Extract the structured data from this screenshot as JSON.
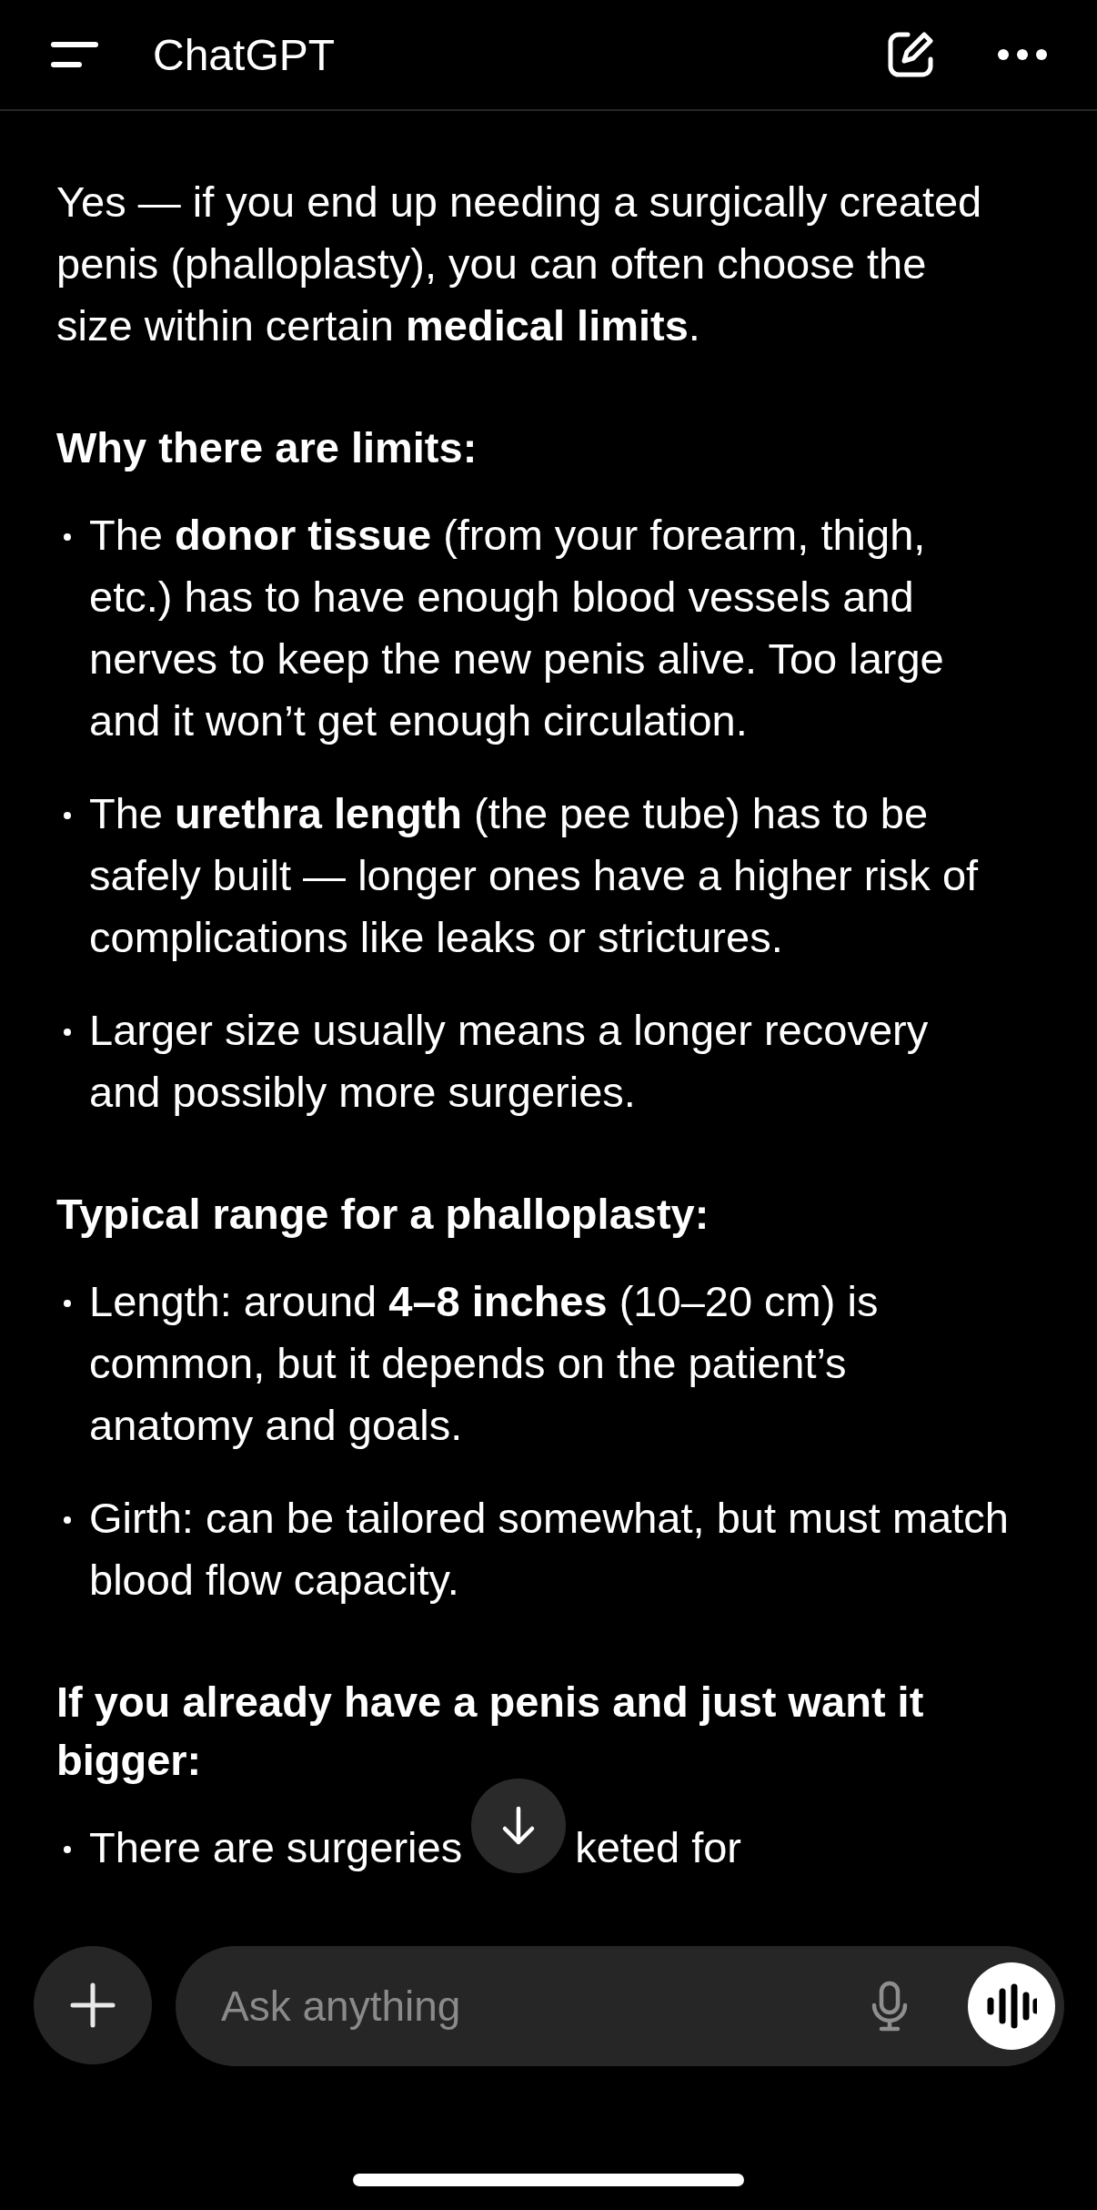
{
  "header": {
    "title": "ChatGPT"
  },
  "message": [
    {
      "kind": "paragraph",
      "text": "Yes — if you end up needing a surgically created penis (phalloplasty), you can often choose the size within certain **medical limits**."
    },
    {
      "kind": "heading",
      "text": "Why there are limits:"
    },
    {
      "kind": "bullets",
      "items": [
        "The **donor tissue** (from your forearm, thigh, etc.) has to have enough blood vessels and nerves to keep the new penis alive. Too large and it won’t get enough circulation.",
        "The **urethra length** (the pee tube) has to be safely built — longer ones have a higher risk of complications like leaks or strictures.",
        "Larger size usually means a longer recovery and possibly more surgeries."
      ]
    },
    {
      "kind": "heading",
      "text": "Typical range for a phalloplasty:"
    },
    {
      "kind": "bullets",
      "items": [
        "Length: around **4–8 inches** (10–20 cm) is common, but it depends on the patient’s anatomy and goals.",
        "Girth: can be tailored somewhat, but must match blood flow capacity."
      ]
    },
    {
      "kind": "heading",
      "text": "If you already have a penis and just want it bigger:"
    },
    {
      "kind": "covered_bullet",
      "before": "There are surgeries",
      "after": "keted for"
    }
  ],
  "composer": {
    "placeholder": "Ask anything"
  }
}
